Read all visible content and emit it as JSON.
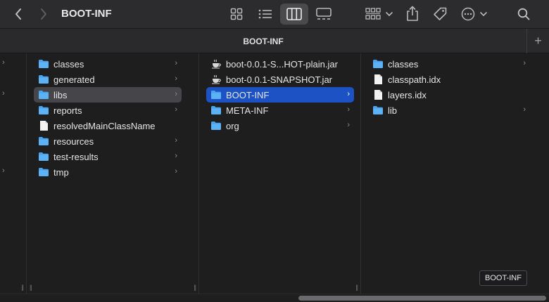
{
  "window": {
    "title": "BOOT-INF"
  },
  "tabbar": {
    "tab_label": "BOOT-INF",
    "add_label": "+"
  },
  "icons": {
    "folder_color": "#4aa3f0",
    "accent_selected": "#1d52c4",
    "selected_inactive": "#46464a"
  },
  "columns": [
    {
      "items": [
        {
          "label": "classes",
          "type": "folder",
          "has_children": true
        },
        {
          "label": "generated",
          "type": "folder",
          "has_children": true
        },
        {
          "label": "libs",
          "type": "folder",
          "has_children": true,
          "selected": "inactive"
        },
        {
          "label": "reports",
          "type": "folder",
          "has_children": true
        },
        {
          "label": "resolvedMainClassName",
          "type": "file",
          "has_children": false
        },
        {
          "label": "resources",
          "type": "folder",
          "has_children": true
        },
        {
          "label": "test-results",
          "type": "folder",
          "has_children": true
        },
        {
          "label": "tmp",
          "type": "folder",
          "has_children": true
        }
      ]
    },
    {
      "items": [
        {
          "label": "boot-0.0.1-S...HOT-plain.jar",
          "type": "jar",
          "has_children": false
        },
        {
          "label": "boot-0.0.1-SNAPSHOT.jar",
          "type": "jar",
          "has_children": false
        },
        {
          "label": "BOOT-INF",
          "type": "folder",
          "has_children": true,
          "selected": "active"
        },
        {
          "label": "META-INF",
          "type": "folder",
          "has_children": true
        },
        {
          "label": "org",
          "type": "folder",
          "has_children": true
        }
      ]
    },
    {
      "items": [
        {
          "label": "classes",
          "type": "folder",
          "has_children": true
        },
        {
          "label": "classpath.idx",
          "type": "file",
          "has_children": false
        },
        {
          "label": "layers.idx",
          "type": "file",
          "has_children": false
        },
        {
          "label": "lib",
          "type": "folder",
          "has_children": true
        }
      ]
    }
  ],
  "tooltip": {
    "text": "BOOT-INF"
  }
}
